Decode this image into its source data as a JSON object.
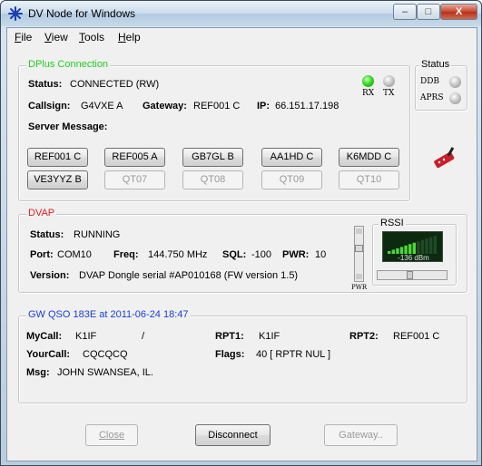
{
  "window": {
    "title": "DV Node for Windows",
    "min": "–",
    "max": "□",
    "close": "X"
  },
  "menu": [
    {
      "u": "F",
      "rest": "ile"
    },
    {
      "u": "V",
      "rest": "iew"
    },
    {
      "u": "T",
      "rest": "ools"
    },
    {
      "u": "H",
      "rest": "elp"
    }
  ],
  "dplus": {
    "legend": "DPlus Connection",
    "status_label": "Status:",
    "status_value": "CONNECTED (RW)",
    "callsign_label": "Callsign:",
    "callsign_value": "G4VXE  A",
    "gateway_label": "Gateway:",
    "gateway_value": "REF001 C",
    "ip_label": "IP:",
    "ip_value": "66.151.17.198",
    "server_msg_label": "Server Message:",
    "rx_label": "RX",
    "tx_label": "TX",
    "buttons": [
      "REF001 C",
      "REF005 A",
      "GB7GL  B",
      "AA1HD  C",
      "K6MDD  C",
      "VE3YYZ B",
      "QT07",
      "QT08",
      "QT09",
      "QT10"
    ]
  },
  "status_panel": {
    "legend": "Status",
    "ddb": "DDB",
    "aprs": "APRS"
  },
  "dvap": {
    "legend": "DVAP",
    "status_label": "Status:",
    "status_value": "RUNNING",
    "port_label": "Port:",
    "port_value": "COM10",
    "freq_label": "Freq:",
    "freq_value": "144.750 MHz",
    "sql_label": "SQL:",
    "sql_value": "-100",
    "pwr_label": "PWR:",
    "pwr_value": "10",
    "version_label": "Version:",
    "version_value": "DVAP Dongle serial #AP010168 (FW version 1.5)",
    "pwr_slider_label": "PWR",
    "rssi_legend": "RSSI",
    "rssi_value": "-136 dBm",
    "rssi_level": 0.55
  },
  "qso": {
    "legend": "GW QSO 183E at 2011-06-24 18:47",
    "mycall_label": "MyCall:",
    "mycall_value": "K1IF",
    "slash": "/",
    "rpt1_label": "RPT1:",
    "rpt1_value": "K1IF",
    "rpt2_label": "RPT2:",
    "rpt2_value": "REF001 C",
    "yourcall_label": "YourCall:",
    "yourcall_value": "CQCQCQ",
    "flags_label": "Flags:",
    "flags_value": "40 [ RPTR  NUL ]",
    "msg_label": "Msg:",
    "msg_value": "JOHN SWANSEA, IL."
  },
  "footer": {
    "close": "Close",
    "disconnect": "Disconnect",
    "gateway": "Gateway.."
  },
  "colors": {
    "dplus_legend": "#22cc22",
    "dvap_legend": "#e02020",
    "qso_legend": "#1a3fd0"
  }
}
